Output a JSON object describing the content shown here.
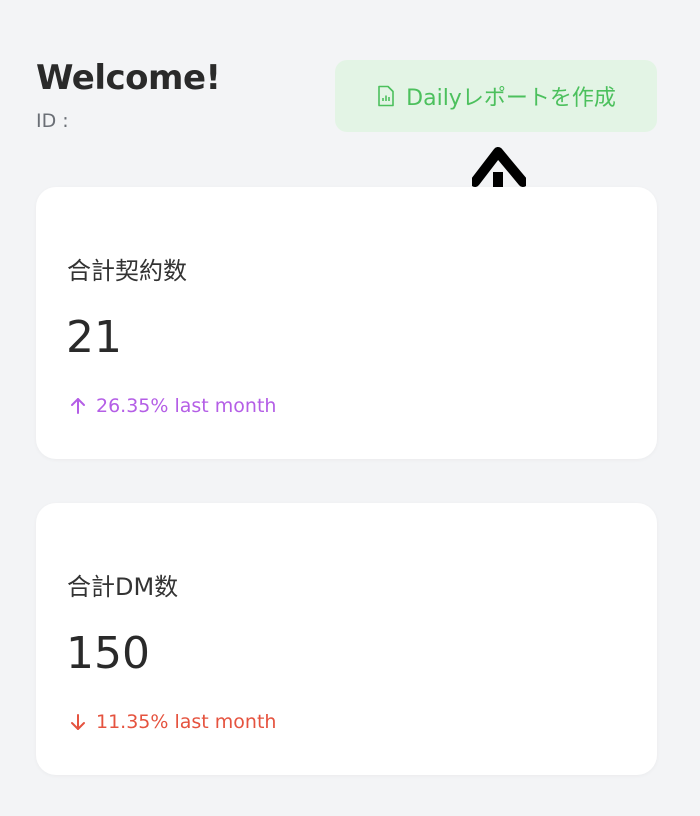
{
  "header": {
    "welcome": "Welcome!",
    "id_label": "ID :"
  },
  "report_button": {
    "label": "Dailyレポートを作成",
    "icon": "report-file-icon"
  },
  "cards": [
    {
      "label": "合計契約数",
      "value": "21",
      "trend": {
        "direction": "up",
        "percent": "26.35%",
        "period": "last month",
        "color": "#b45ee6"
      }
    },
    {
      "label": "合計DM数",
      "value": "150",
      "trend": {
        "direction": "down",
        "percent": "11.35%",
        "period": "last month",
        "color": "#e5533f"
      }
    }
  ],
  "colors": {
    "background": "#f3f4f6",
    "button_bg": "#e3f4e5",
    "button_text": "#4cc05d"
  }
}
